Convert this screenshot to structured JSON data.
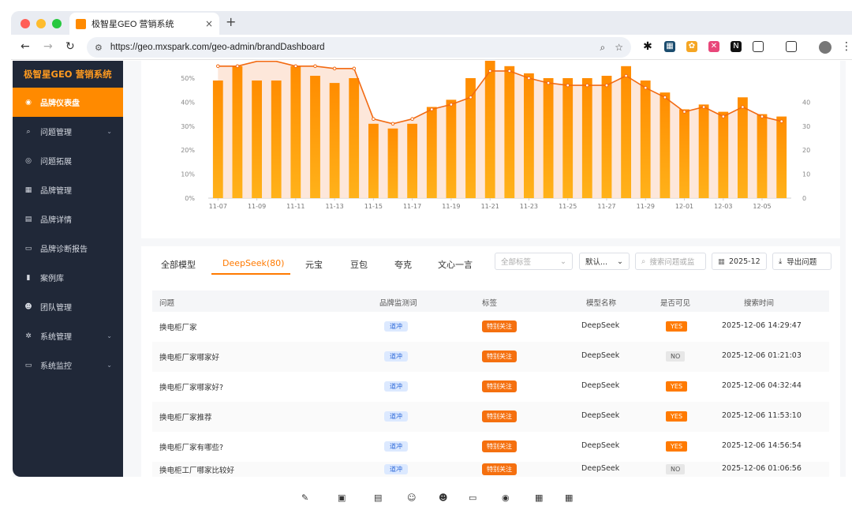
{
  "browser": {
    "tab_title": "极智星GEO 营销系统",
    "url": "https://geo.mxspark.com/geo-admin/brandDashboard",
    "window_controls": {
      "close": "#ff5f57",
      "minimize": "#febc2e",
      "maximize": "#28c840"
    }
  },
  "sidebar": {
    "brand": "极智星GEO 营销系统",
    "items": [
      {
        "label": "品牌仪表盘",
        "icon": "dashboard-icon",
        "active": true
      },
      {
        "label": "问题管理",
        "icon": "search-icon",
        "expandable": true
      },
      {
        "label": "问题拓展",
        "icon": "target-icon"
      },
      {
        "label": "品牌管理",
        "icon": "grid-icon"
      },
      {
        "label": "品牌详情",
        "icon": "grid-icon"
      },
      {
        "label": "品牌诊断报告",
        "icon": "report-icon"
      },
      {
        "label": "案例库",
        "icon": "book-icon"
      },
      {
        "label": "团队管理",
        "icon": "team-icon"
      },
      {
        "label": "系统管理",
        "icon": "gear-icon",
        "expandable": true
      },
      {
        "label": "系统监控",
        "icon": "monitor-icon",
        "expandable": true
      }
    ]
  },
  "chart_data": {
    "type": "bar",
    "categories": [
      "11-07",
      "11-08",
      "11-09",
      "11-10",
      "11-11",
      "11-12",
      "11-13",
      "11-14",
      "11-15",
      "11-16",
      "11-17",
      "11-18",
      "11-19",
      "11-20",
      "11-21",
      "11-22",
      "11-23",
      "11-24",
      "11-25",
      "11-26",
      "11-27",
      "11-28",
      "11-29",
      "11-30",
      "12-01",
      "12-02",
      "12-03",
      "12-04",
      "12-05",
      "12-06"
    ],
    "x_tick_labels": [
      "11-07",
      "11-09",
      "11-11",
      "11-13",
      "11-15",
      "11-17",
      "11-19",
      "11-21",
      "11-23",
      "11-25",
      "11-27",
      "11-29",
      "12-01",
      "12-03",
      "12-05"
    ],
    "series": [
      {
        "values": [
          49,
          55,
          49,
          49,
          55,
          51,
          48,
          50,
          31,
          29,
          31,
          38,
          41,
          50,
          58,
          55,
          52,
          50,
          50,
          50,
          51,
          55,
          49,
          44,
          37,
          39,
          36,
          42,
          35,
          34
        ],
        "axis": "left",
        "kind": "bar",
        "color": "#ff9a0a"
      },
      {
        "values": [
          55,
          55,
          57,
          57,
          55,
          55,
          54,
          54,
          33,
          31,
          33,
          37,
          39,
          42,
          53,
          53,
          50,
          48,
          47,
          47,
          47,
          51,
          46,
          42,
          36,
          38,
          34,
          38,
          34,
          32
        ],
        "axis": "right",
        "kind": "area-line",
        "color": "#f26a12"
      }
    ],
    "ylim": [
      0,
      50
    ],
    "y_ticks": [
      "0%",
      "10%",
      "20%",
      "30%",
      "40%",
      "50%"
    ],
    "y2lim": [
      0,
      45
    ],
    "y2_ticks": [
      "0",
      "10",
      "20",
      "30",
      "40"
    ],
    "grid": false
  },
  "model_tabs": [
    {
      "label": "全部模型"
    },
    {
      "label": "DeepSeek(80)",
      "active": true
    },
    {
      "label": "元宝"
    },
    {
      "label": "豆包"
    },
    {
      "label": "夸克"
    },
    {
      "label": "文心一言"
    }
  ],
  "filters": {
    "tag_placeholder": "全部标签",
    "sort_value": "默认...",
    "search_placeholder": "搜索问题或监",
    "date_value": "2025-12-",
    "export_label": "导出问题"
  },
  "table": {
    "columns": [
      "问题",
      "品牌监测词",
      "标签",
      "模型名称",
      "是否可见",
      "搜索时间"
    ],
    "rows": [
      {
        "question": "换电柜厂家",
        "keyword": "道冲",
        "tag": "特别关注",
        "model": "DeepSeek",
        "visible": "YES",
        "time": "2025-12-06 14:29:47"
      },
      {
        "question": "换电柜厂家哪家好",
        "keyword": "道冲",
        "tag": "特别关注",
        "model": "DeepSeek",
        "visible": "NO",
        "time": "2025-12-06 01:21:03"
      },
      {
        "question": "换电柜厂家哪家好?",
        "keyword": "道冲",
        "tag": "特别关注",
        "model": "DeepSeek",
        "visible": "YES",
        "time": "2025-12-06 04:32:44"
      },
      {
        "question": "换电柜厂家推荐",
        "keyword": "道冲",
        "tag": "特别关注",
        "model": "DeepSeek",
        "visible": "YES",
        "time": "2025-12-06 11:53:10"
      },
      {
        "question": "换电柜厂家有哪些?",
        "keyword": "道冲",
        "tag": "特别关注",
        "model": "DeepSeek",
        "visible": "YES",
        "time": "2025-12-06 14:56:54"
      },
      {
        "question": "换电柜工厂哪家比较好",
        "keyword": "道冲",
        "tag": "特别关注",
        "model": "DeepSeek",
        "visible": "NO",
        "time": "2025-12-06 01:06:56"
      }
    ]
  }
}
